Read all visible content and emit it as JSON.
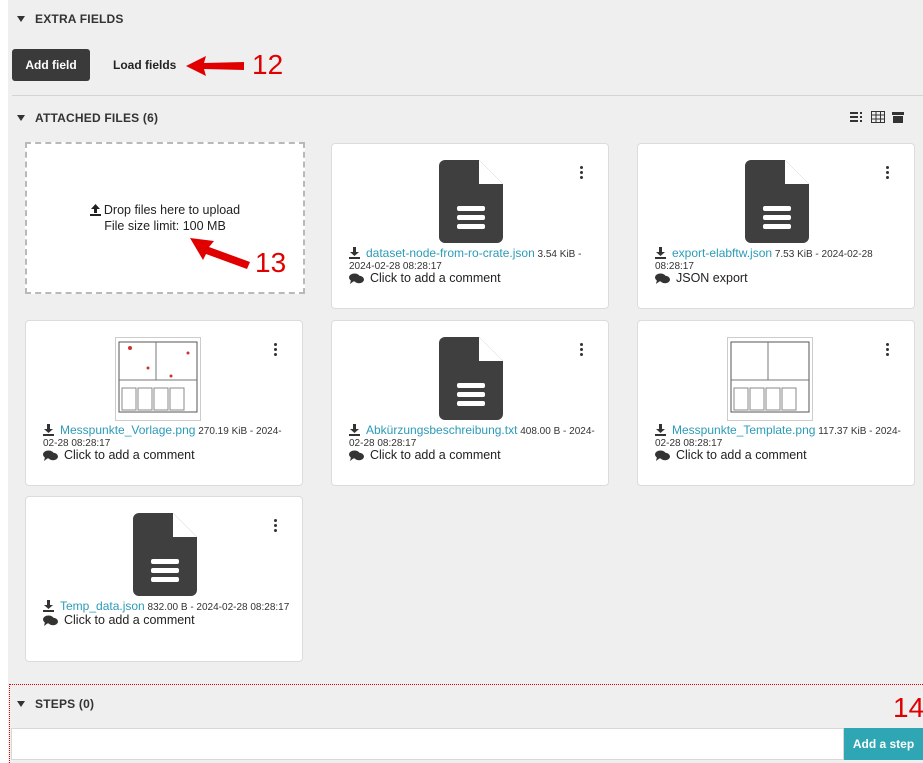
{
  "extra_fields": {
    "title": "EXTRA FIELDS",
    "add_field_label": "Add field",
    "load_fields_label": "Load fields"
  },
  "attached_files": {
    "title": "ATTACHED FILES (6)",
    "dropzone": {
      "line1": "Drop files here to upload",
      "line2": "File size limit: 100 MB"
    },
    "files": [
      {
        "name": "dataset-node-from-ro-crate.json",
        "meta": "3.54 KiB - 2024-02-28 08:28:17",
        "comment": "Click to add a comment",
        "preview": "document-icon"
      },
      {
        "name": "export-elabftw.json",
        "meta": "7.53 KiB - 2024-02-28 08:28:17",
        "comment": "JSON export",
        "preview": "document-icon"
      },
      {
        "name": "Messpunkte_Vorlage.png",
        "meta": "270.19 KiB - 2024-02-28 08:28:17",
        "comment": "Click to add a comment",
        "preview": "floorplan-thumbnail"
      },
      {
        "name": "Abkürzungsbeschreibung.txt",
        "meta": "408.00 B - 2024-02-28 08:28:17",
        "comment": "Click to add a comment",
        "preview": "document-icon"
      },
      {
        "name": "Messpunkte_Template.png",
        "meta": "117.37 KiB - 2024-02-28 08:28:17",
        "comment": "Click to add a comment",
        "preview": "floorplan-thumbnail"
      },
      {
        "name": "Temp_data.json",
        "meta": "832.00 B - 2024-02-28 08:28:17",
        "comment": "Click to add a comment",
        "preview": "document-icon"
      }
    ]
  },
  "steps": {
    "title": "STEPS (0)",
    "add_step_label": "Add a step"
  },
  "annotations": {
    "a12": "12",
    "a13": "13",
    "a14": "14"
  },
  "colors": {
    "accent": "#2fa6b3",
    "link": "#2a9bb8",
    "annotation": "#e00000",
    "dark_button": "#3a3a3a"
  }
}
